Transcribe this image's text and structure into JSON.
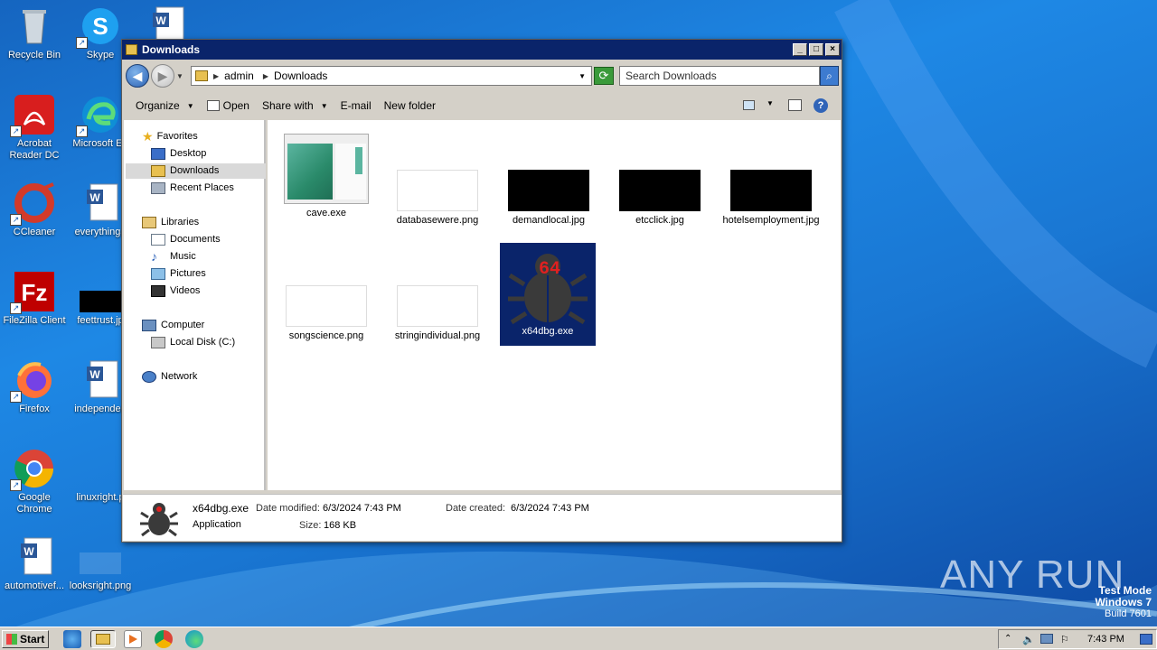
{
  "desktop": {
    "icons": [
      {
        "label": "Recycle Bin"
      },
      {
        "label": "Skype"
      },
      {
        "label": "Acrobat Reader DC"
      },
      {
        "label": "Microsoft Ed"
      },
      {
        "label": "CCleaner"
      },
      {
        "label": "everythinga"
      },
      {
        "label": "FileZilla Client"
      },
      {
        "label": "feettrust.jp"
      },
      {
        "label": "Firefox"
      },
      {
        "label": "independen"
      },
      {
        "label": "Google Chrome"
      },
      {
        "label": "linuxright.p"
      },
      {
        "label": "automotivef..."
      },
      {
        "label": "looksright.png"
      }
    ],
    "watermark": "ANY RUN",
    "test_mode": {
      "line1": "Test Mode",
      "line2": "Windows 7",
      "line3": "Build 7601"
    }
  },
  "window": {
    "title": "Downloads",
    "controls": {
      "minimize": "_",
      "maximize": "□",
      "close": "×"
    },
    "breadcrumb": [
      "admin",
      "Downloads"
    ],
    "search": {
      "placeholder": "Search Downloads"
    },
    "toolbar": {
      "organize": "Organize",
      "open": "Open",
      "share_with": "Share with",
      "email": "E-mail",
      "new_folder": "New folder"
    },
    "nav": {
      "favorites": "Favorites",
      "desktop": "Desktop",
      "downloads": "Downloads",
      "recent": "Recent Places",
      "libraries": "Libraries",
      "documents": "Documents",
      "music": "Music",
      "pictures": "Pictures",
      "videos": "Videos",
      "computer": "Computer",
      "local_disk": "Local Disk (C:)",
      "network": "Network"
    },
    "files": [
      {
        "name": "cave.exe"
      },
      {
        "name": "databasewere.png"
      },
      {
        "name": "demandlocal.jpg"
      },
      {
        "name": "etcclick.jpg"
      },
      {
        "name": "hotelsemployment.jpg"
      },
      {
        "name": "songscience.png"
      },
      {
        "name": "stringindividual.png"
      },
      {
        "name": "x64dbg.exe",
        "badge": "64"
      }
    ],
    "details": {
      "filename": "x64dbg.exe",
      "type": "Application",
      "modified_label": "Date modified:",
      "modified": "6/3/2024 7:43 PM",
      "size_label": "Size:",
      "size": "168 KB",
      "created_label": "Date created:",
      "created": "6/3/2024 7:43 PM"
    }
  },
  "taskbar": {
    "start": "Start",
    "clock": "7:43 PM"
  },
  "colors": {
    "title_bar": "#0a246a",
    "selection": "#0a246a",
    "desktop": "#1976d2"
  }
}
